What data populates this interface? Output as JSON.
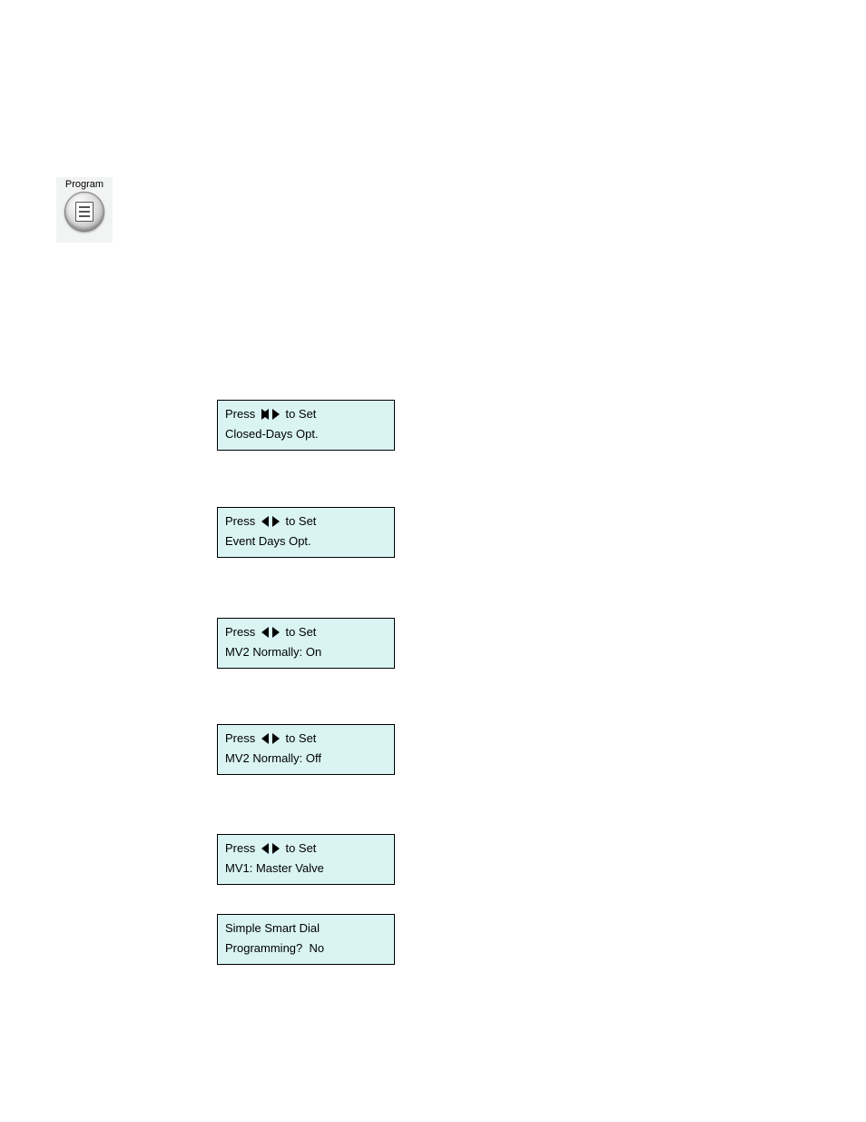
{
  "programButton": {
    "label": "Program"
  },
  "lcd": [
    {
      "line1_before": "Press ",
      "line1_after": " to Set",
      "line2": "Closed-Days Opt."
    },
    {
      "line1_before": "Press ",
      "line1_after": " to Set",
      "line2": "Event Days Opt."
    },
    {
      "line1_before": "Press ",
      "line1_after": " to Set",
      "line2": "MV2 Normally: On"
    },
    {
      "line1_before": "Press ",
      "line1_after": " to Set",
      "line2": "MV2 Normally: Off"
    },
    {
      "line1_before": "Press ",
      "line1_after": " to Set",
      "line2": "MV1: Master Valve"
    },
    {
      "line1": "Simple Smart Dial",
      "line2": "Programming?  No"
    }
  ]
}
